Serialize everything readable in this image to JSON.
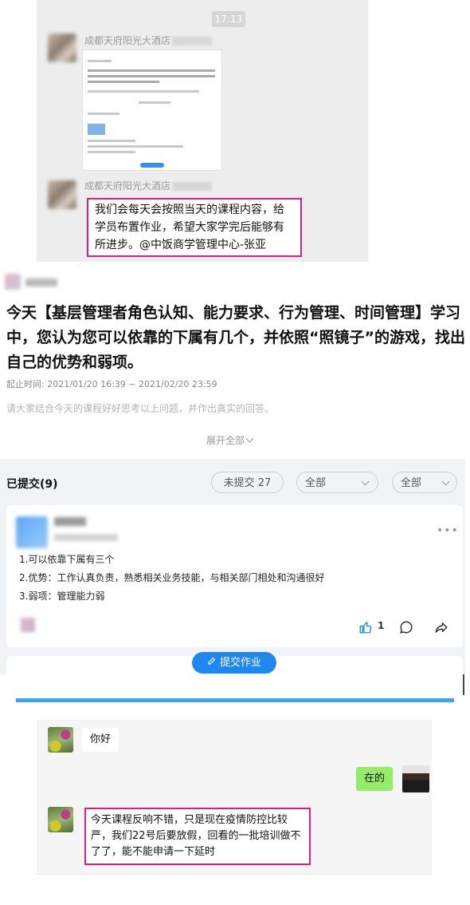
{
  "chat_top": {
    "time": "17:13",
    "sender1": "成都天府阳光大酒店",
    "sender2": "成都天府阳光大酒店",
    "message": "我们会每天会按照当天的课程内容，给学员布置作业，希望大家学完后能够有所进步。@中饭商学管理中心-张亚"
  },
  "task": {
    "title": "今天【基层管理者角色认知、能力要求、行为管理、时间管理】学习中，您认为您可以依靠的下属有几个，并依照“照镜子”的游戏，找出自己的优势和弱项。",
    "time_range": "起止时间: 2021/01/20 16:39 ~ 2021/02/20 23:59",
    "description": "请大家结合今天的课程好好思考以上问题，并作出真实的回答。",
    "expand_label": "展开全部"
  },
  "submissions": {
    "submitted_label": "已提交",
    "submitted_count": "(9)",
    "not_submitted_filter": "未提交 27",
    "filter1": "全部",
    "filter2": "全部",
    "answer_lines": [
      "1.可以依靠下属有三个",
      "2.优势：工作认真负责，熟悉相关业务技能，与相关部门相处和沟通很好",
      "3.弱项：管理能力弱"
    ],
    "like_count": "1",
    "submit_button": "提交作业"
  },
  "chat_bottom": {
    "msg1": "你好",
    "reply": "在的",
    "msg2": "今天课程反响不错，只是现在疫情防控比较严，我们22号后要放假，回看的一批培训做不了了，能不能申请一下延时"
  },
  "colors": {
    "highlight_border": "#d4237a",
    "primary_blue": "#1e87f0",
    "wechat_green": "#95ec69"
  }
}
